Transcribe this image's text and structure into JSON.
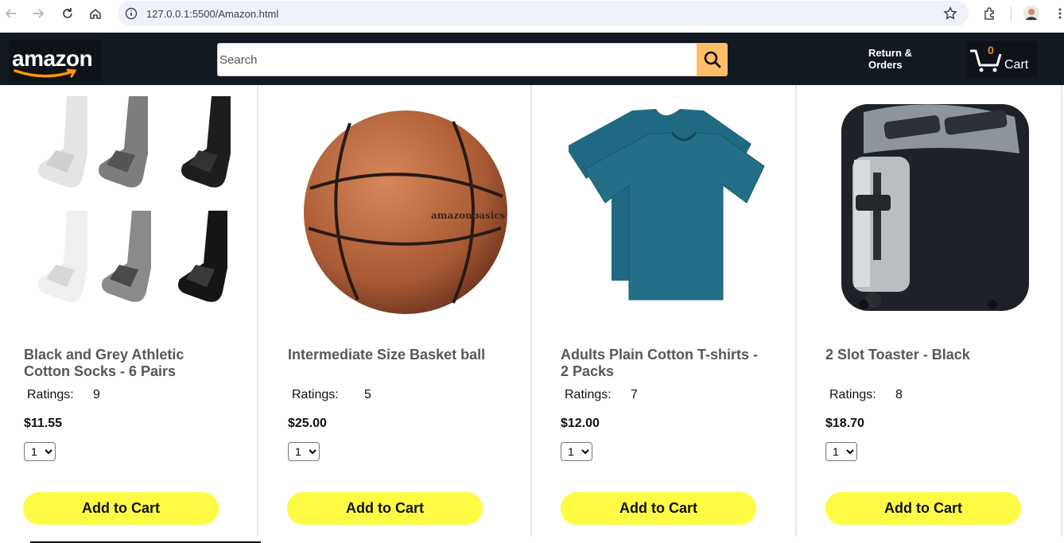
{
  "browser": {
    "url": "127.0.0.1:5500/Amazon.html"
  },
  "header": {
    "logo_text": "amazon",
    "search_placeholder": "Search",
    "orders_line1": "Return &",
    "orders_line2": "Orders",
    "cart_count": "0",
    "cart_label": "Cart"
  },
  "products": [
    {
      "title_line1": "Black and Grey Athletic",
      "title_line2": "Cotton Socks - 6 Pairs",
      "ratings_label": "Ratings:",
      "ratings": "9",
      "price": "$11.55",
      "qty": "1",
      "button": "Add to Cart"
    },
    {
      "title_line1": "Intermediate Size Basket ball",
      "title_line2": "",
      "ratings_label": "Ratings:",
      "ratings": "5",
      "price": "$25.00",
      "qty": "1",
      "button": "Add to Cart"
    },
    {
      "title_line1": "Adults Plain Cotton T-shirts -",
      "title_line2": "2 Packs",
      "ratings_label": "Ratings:",
      "ratings": "7",
      "price": "$12.00",
      "qty": "1",
      "button": "Add to Cart"
    },
    {
      "title_line1": "2 Slot Toaster - Black",
      "title_line2": "",
      "ratings_label": "Ratings:",
      "ratings": "8",
      "price": "$18.70",
      "qty": "1",
      "button": "Add to Cart"
    }
  ],
  "product_images": [
    "socks-image",
    "basketball-image",
    "tshirt-image",
    "toaster-image"
  ]
}
